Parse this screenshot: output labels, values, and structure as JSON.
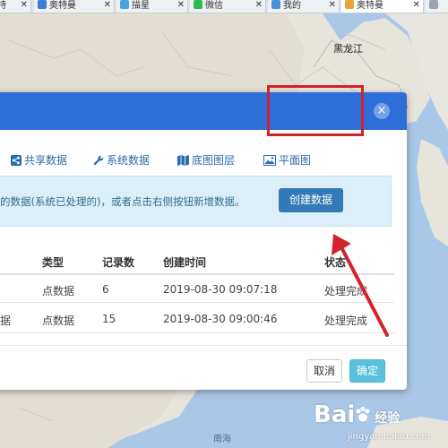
{
  "browser_tabs": [
    {
      "label": "奥特",
      "fav_color": "#3a7bd5",
      "active": false
    },
    {
      "label": "奥特曼",
      "fav_color": "#3a7bd5",
      "active": false
    },
    {
      "label": "描星",
      "fav_color": "#4aa3df",
      "active": false
    },
    {
      "label": "微信",
      "fav_color": "#2dbb4f",
      "active": false
    },
    {
      "label": "我的",
      "fav_color": "#4a90d9",
      "active": false
    },
    {
      "label": "奥特曼",
      "fav_color": "#e8a33b",
      "active": true
    },
    {
      "label": "",
      "fav_color": "#9aa5b1",
      "active": false
    }
  ],
  "map": {
    "labels": {
      "heilongjiang": "黑龙江",
      "nanhai": "南海"
    }
  },
  "modal": {
    "close_glyph": "×",
    "tabs": [
      {
        "icon": "share-icon",
        "label": "共享数据"
      },
      {
        "icon": "wrench-icon",
        "label": "系统数据"
      },
      {
        "icon": "map-icon",
        "label": "底图图层"
      },
      {
        "icon": "image-icon",
        "label": "平面图"
      }
    ],
    "alert_text": "的数据(系统已处理的)，或者点击右侧按钮新增数据。",
    "create_button": "创建数据",
    "table": {
      "headers": [
        "类型",
        "记录数",
        "创建时间",
        "状态"
      ],
      "rows": [
        {
          "name": "",
          "type": "点数据",
          "count": "6",
          "created": "2019-08-30 09:07:18",
          "status": "处理完成"
        },
        {
          "name": "据",
          "type": "点数据",
          "count": "15",
          "created": "2019-08-30 09:00:46",
          "status": "处理完成"
        }
      ]
    },
    "cancel_button": "取消",
    "ok_button": "确定"
  },
  "watermark": {
    "logo": "Bai",
    "logo_suffix": "经验",
    "url": "jingyan.baidu.com"
  },
  "colors": {
    "header_blue": "#2e6ed9",
    "primary": "#337ab7",
    "info": "#5bc0de",
    "highlight_red": "#d2232a"
  }
}
